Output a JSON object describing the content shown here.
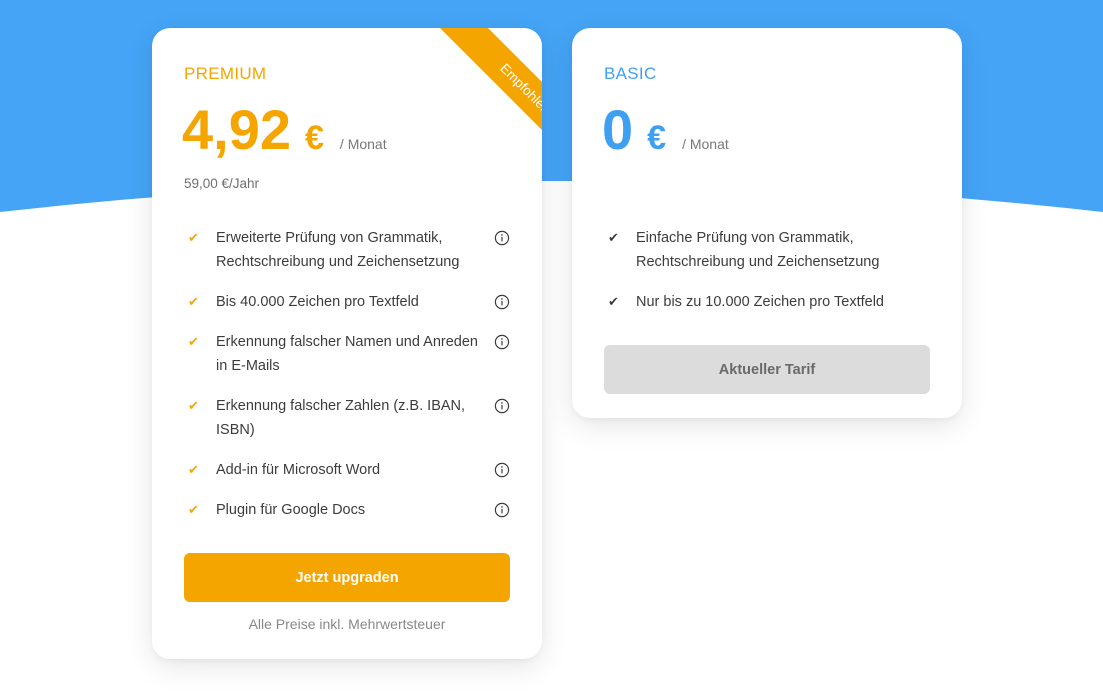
{
  "colors": {
    "background_blue": "#45a4f6",
    "premium_accent": "#f5a500",
    "basic_accent": "#3fa0f2",
    "disabled_button": "#dcdcdc"
  },
  "premium": {
    "name": "PREMIUM",
    "ribbon": "Empfohlen",
    "price": "4,92",
    "currency": "€",
    "period": "/ Monat",
    "yearly": "59,00 €/Jahr",
    "features": [
      {
        "label": "Erweiterte Prüfung von Grammatik, Rechtschreibung und Zeichensetzung",
        "check_icon": "check-icon",
        "info_icon": "info-icon"
      },
      {
        "label": "Bis 40.000 Zeichen pro Textfeld",
        "check_icon": "check-icon",
        "info_icon": "info-icon"
      },
      {
        "label": "Erkennung falscher Namen und Anreden in E-Mails",
        "check_icon": "check-icon",
        "info_icon": "info-icon"
      },
      {
        "label": "Erkennung falscher Zahlen (z.B. IBAN, ISBN)",
        "check_icon": "check-icon",
        "info_icon": "info-icon"
      },
      {
        "label": "Add-in für Microsoft Word",
        "check_icon": "check-icon",
        "info_icon": "info-icon"
      },
      {
        "label": "Plugin für Google Docs",
        "check_icon": "check-icon",
        "info_icon": "info-icon"
      }
    ],
    "button": "Jetzt upgraden",
    "footnote": "Alle Preise inkl. Mehrwertsteuer"
  },
  "basic": {
    "name": "BASIC",
    "price": "0",
    "currency": "€",
    "period": "/ Monat",
    "features": [
      {
        "label": "Einfache Prüfung von Grammatik, Rechtschreibung und Zeichensetzung",
        "check_icon": "check-icon"
      },
      {
        "label": "Nur bis zu 10.000 Zeichen pro Textfeld",
        "check_icon": "check-icon"
      }
    ],
    "button": "Aktueller Tarif"
  }
}
